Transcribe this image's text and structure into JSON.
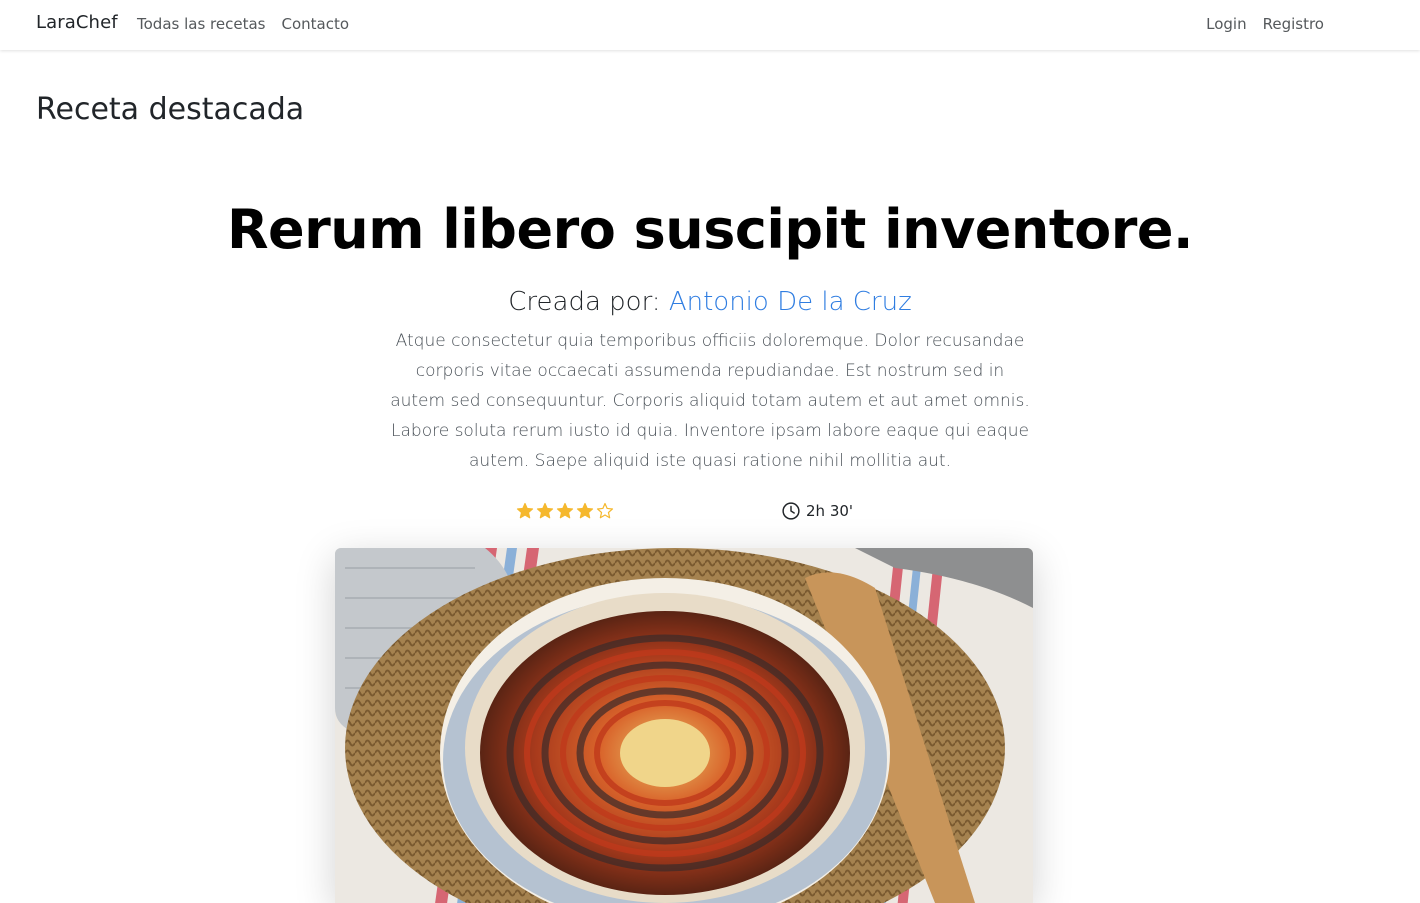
{
  "navbar": {
    "brand": "LaraChef",
    "left_links": [
      "Todas las recetas",
      "Contacto"
    ],
    "right_links": [
      "Login",
      "Registro"
    ]
  },
  "section": {
    "title": "Receta destacada"
  },
  "recipe": {
    "title": "Rerum libero suscipit inventore.",
    "author_prefix": "Creada por:",
    "author_name": "Antonio De la Cruz",
    "description": "Atque consectetur quia temporibus officiis doloremque. Dolor recusandae corporis vitae occaecati assumenda repudiandae. Est nostrum sed in autem sed consequuntur. Corporis aliquid totam autem et aut amet omnis. Labore soluta rerum iusto id quia. Inventore ipsam labore eaque qui eaque autem. Saepe aliquid iste quasi ratione nihil mollitia aut.",
    "rating": 4,
    "rating_max": 5,
    "time": "2h 30'",
    "image_subject": "ratatouille-dish"
  },
  "colors": {
    "star": "#f5b82e",
    "link": "#2f7de1",
    "text": "#212529"
  }
}
